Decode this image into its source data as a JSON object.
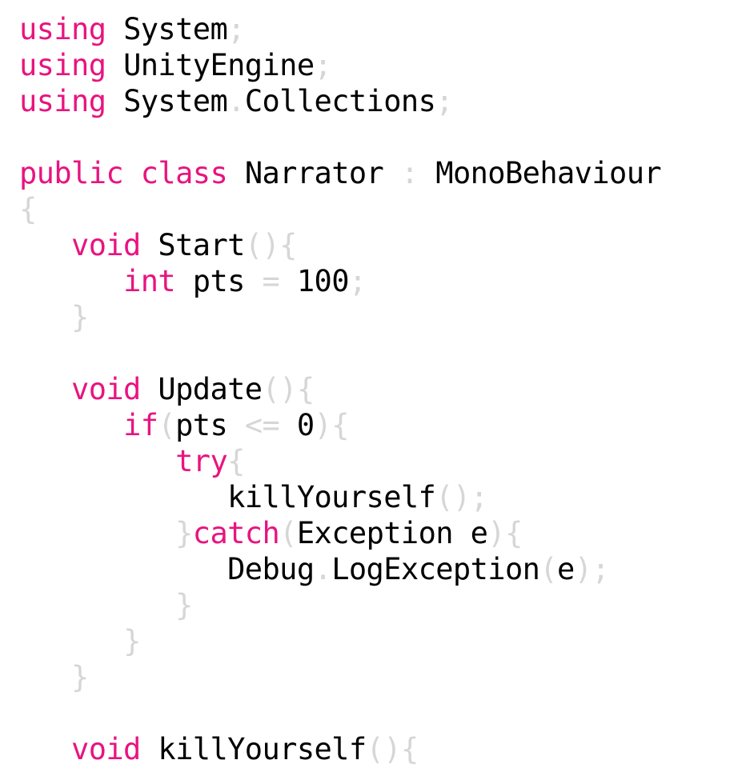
{
  "colors": {
    "keyword": "#e8147f",
    "identifier": "#000000",
    "punctuation": "#d6d6d6",
    "background": "#ffffff"
  },
  "code": {
    "lines": [
      {
        "tokens": [
          {
            "t": "kw",
            "v": "using"
          },
          {
            "t": "id",
            "v": " System"
          },
          {
            "t": "punct",
            "v": ";"
          }
        ]
      },
      {
        "tokens": [
          {
            "t": "kw",
            "v": "using"
          },
          {
            "t": "id",
            "v": " UnityEngine"
          },
          {
            "t": "punct",
            "v": ";"
          }
        ]
      },
      {
        "tokens": [
          {
            "t": "kw",
            "v": "using"
          },
          {
            "t": "id",
            "v": " System"
          },
          {
            "t": "punct",
            "v": "."
          },
          {
            "t": "id",
            "v": "Collections"
          },
          {
            "t": "punct",
            "v": ";"
          }
        ]
      },
      {
        "tokens": []
      },
      {
        "tokens": [
          {
            "t": "kw",
            "v": "public"
          },
          {
            "t": "id",
            "v": " "
          },
          {
            "t": "kw",
            "v": "class"
          },
          {
            "t": "id",
            "v": " Narrator "
          },
          {
            "t": "punct",
            "v": ":"
          },
          {
            "t": "id",
            "v": " MonoBehaviour"
          }
        ]
      },
      {
        "tokens": [
          {
            "t": "punct",
            "v": "{"
          }
        ]
      },
      {
        "tokens": [
          {
            "t": "id",
            "v": "   "
          },
          {
            "t": "kw",
            "v": "void"
          },
          {
            "t": "id",
            "v": " Start"
          },
          {
            "t": "punct",
            "v": "(){"
          }
        ]
      },
      {
        "tokens": [
          {
            "t": "id",
            "v": "      "
          },
          {
            "t": "kw",
            "v": "int"
          },
          {
            "t": "id",
            "v": " pts "
          },
          {
            "t": "punct",
            "v": "="
          },
          {
            "t": "id",
            "v": " 100"
          },
          {
            "t": "punct",
            "v": ";"
          }
        ]
      },
      {
        "tokens": [
          {
            "t": "id",
            "v": "   "
          },
          {
            "t": "punct",
            "v": "}"
          }
        ]
      },
      {
        "tokens": []
      },
      {
        "tokens": [
          {
            "t": "id",
            "v": "   "
          },
          {
            "t": "kw",
            "v": "void"
          },
          {
            "t": "id",
            "v": " Update"
          },
          {
            "t": "punct",
            "v": "(){"
          }
        ]
      },
      {
        "tokens": [
          {
            "t": "id",
            "v": "      "
          },
          {
            "t": "kw",
            "v": "if"
          },
          {
            "t": "punct",
            "v": "("
          },
          {
            "t": "id",
            "v": "pts "
          },
          {
            "t": "punct",
            "v": "<="
          },
          {
            "t": "id",
            "v": " 0"
          },
          {
            "t": "punct",
            "v": "){"
          }
        ]
      },
      {
        "tokens": [
          {
            "t": "id",
            "v": "         "
          },
          {
            "t": "kw",
            "v": "try"
          },
          {
            "t": "punct",
            "v": "{"
          }
        ]
      },
      {
        "tokens": [
          {
            "t": "id",
            "v": "            killYourself"
          },
          {
            "t": "punct",
            "v": "();"
          }
        ]
      },
      {
        "tokens": [
          {
            "t": "id",
            "v": "         "
          },
          {
            "t": "punct",
            "v": "}"
          },
          {
            "t": "kw",
            "v": "catch"
          },
          {
            "t": "punct",
            "v": "("
          },
          {
            "t": "id",
            "v": "Exception e"
          },
          {
            "t": "punct",
            "v": "){"
          }
        ]
      },
      {
        "tokens": [
          {
            "t": "id",
            "v": "            Debug"
          },
          {
            "t": "punct",
            "v": "."
          },
          {
            "t": "id",
            "v": "LogException"
          },
          {
            "t": "punct",
            "v": "("
          },
          {
            "t": "id",
            "v": "e"
          },
          {
            "t": "punct",
            "v": ");"
          }
        ]
      },
      {
        "tokens": [
          {
            "t": "id",
            "v": "         "
          },
          {
            "t": "punct",
            "v": "}"
          }
        ]
      },
      {
        "tokens": [
          {
            "t": "id",
            "v": "      "
          },
          {
            "t": "punct",
            "v": "}"
          }
        ]
      },
      {
        "tokens": [
          {
            "t": "id",
            "v": "   "
          },
          {
            "t": "punct",
            "v": "}"
          }
        ]
      },
      {
        "tokens": []
      },
      {
        "tokens": [
          {
            "t": "id",
            "v": "   "
          },
          {
            "t": "kw",
            "v": "void"
          },
          {
            "t": "id",
            "v": " killYourself"
          },
          {
            "t": "punct",
            "v": "(){"
          }
        ]
      }
    ]
  }
}
